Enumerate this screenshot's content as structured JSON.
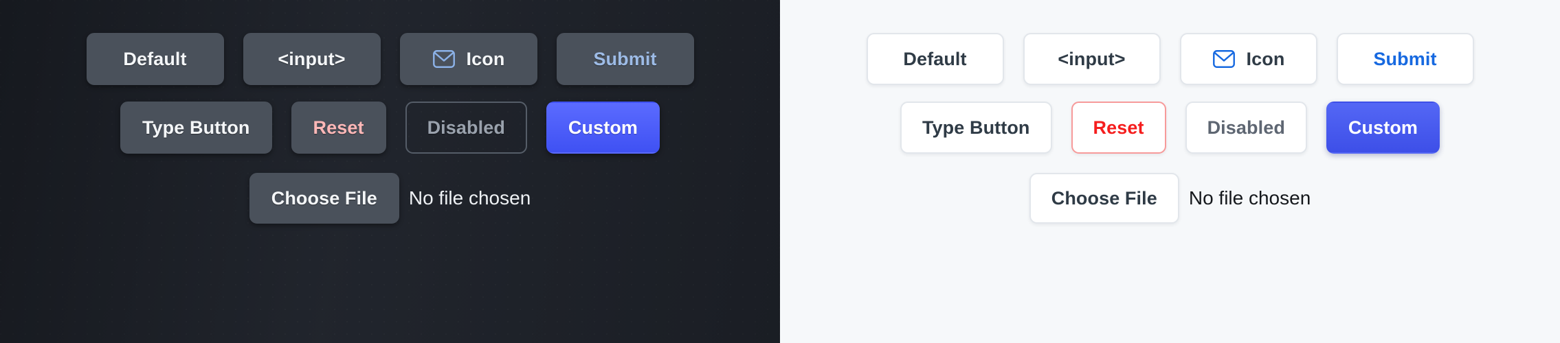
{
  "panels": [
    {
      "theme": "dark",
      "background_color": "#22262e",
      "rows": [
        {
          "buttons": [
            {
              "label": "Default",
              "icon": null
            },
            {
              "label": "<input>",
              "icon": null
            },
            {
              "label": "Icon",
              "icon": "envelope-icon"
            },
            {
              "label": "Submit",
              "icon": null
            }
          ]
        },
        {
          "buttons": [
            {
              "label": "Type Button",
              "icon": null
            },
            {
              "label": "Reset",
              "icon": null
            },
            {
              "label": "Disabled",
              "icon": null
            },
            {
              "label": "Custom",
              "icon": null
            }
          ]
        }
      ],
      "file_row": {
        "button_label": "Choose File",
        "status_text": "No file chosen"
      },
      "colors": {
        "button_fill": "#4a515b",
        "text": "#f4f6f8",
        "submit_text": "#9dbbe6",
        "reset_text": "#ffb8b8",
        "disabled_text": "#9aa2ad",
        "disabled_border": "#555d68",
        "custom_fill": "#4f5ef8",
        "icon": "#8cb2e8"
      }
    },
    {
      "theme": "light",
      "background_color": "#f6f8fa",
      "rows": [
        {
          "buttons": [
            {
              "label": "Default",
              "icon": null
            },
            {
              "label": "<input>",
              "icon": null
            },
            {
              "label": "Icon",
              "icon": "envelope-icon"
            },
            {
              "label": "Submit",
              "icon": null
            }
          ]
        },
        {
          "buttons": [
            {
              "label": "Type Button",
              "icon": null
            },
            {
              "label": "Reset",
              "icon": null
            },
            {
              "label": "Disabled",
              "icon": null
            },
            {
              "label": "Custom",
              "icon": null
            }
          ]
        }
      ],
      "file_row": {
        "button_label": "Choose File",
        "status_text": "No file chosen"
      },
      "colors": {
        "button_fill": "#ffffff",
        "border": "#e2e6eb",
        "text": "#2f3b46",
        "submit_text": "#1769e0",
        "reset_text": "#f51d1d",
        "reset_border": "#f79a9a",
        "disabled_text": "#5e6672",
        "custom_fill": "#4557ef",
        "icon": "#1769e0"
      }
    }
  ]
}
